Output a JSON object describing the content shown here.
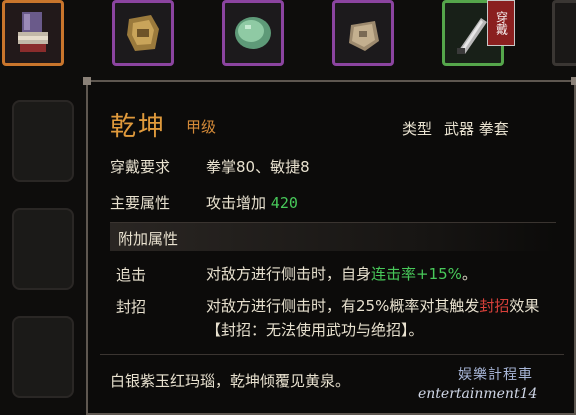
{
  "item": {
    "name": "乾坤",
    "grade": "甲级",
    "type_label": "类型",
    "type_value": "武器 拳套",
    "requirement_label": "穿戴要求",
    "requirement_value": "拳掌80、敏捷8",
    "main_attr_label": "主要属性",
    "main_attr_value": "攻击增加",
    "main_attr_number": "420",
    "extra_section_label": "附加属性",
    "skills": [
      {
        "name": "追击",
        "desc_prefix": "对敌方进行侧击时，自身",
        "desc_highlight": "连击率+15%",
        "desc_suffix": "。"
      },
      {
        "name": "封招",
        "desc_prefix": "对敌方进行侧击时，有25%概率对其触发",
        "desc_highlight": "封招",
        "desc_suffix": "效果【封招：无法使用武功与绝招】。"
      }
    ],
    "flavor": "白银紫玉红玛瑙，乾坤倾覆见黄泉。"
  },
  "equipped_badge": "穿戴",
  "watermark": {
    "line1": "娱樂計程車",
    "line2": "entertainment14"
  },
  "colors": {
    "name": "#e09a3c",
    "green": "#48c95a",
    "red": "#d8403a",
    "purple_border": "#8b44a0",
    "orange_border": "#c9752c",
    "green_border": "#55a64b"
  },
  "slots": [
    {
      "icon": "glove-icon",
      "frame": "orange"
    },
    {
      "icon": "bracer-icon",
      "frame": "purple"
    },
    {
      "icon": "jade-icon",
      "frame": "purple"
    },
    {
      "icon": "pouch-icon",
      "frame": "purple"
    },
    {
      "icon": "blade-icon",
      "frame": "green",
      "equipped": true
    }
  ]
}
